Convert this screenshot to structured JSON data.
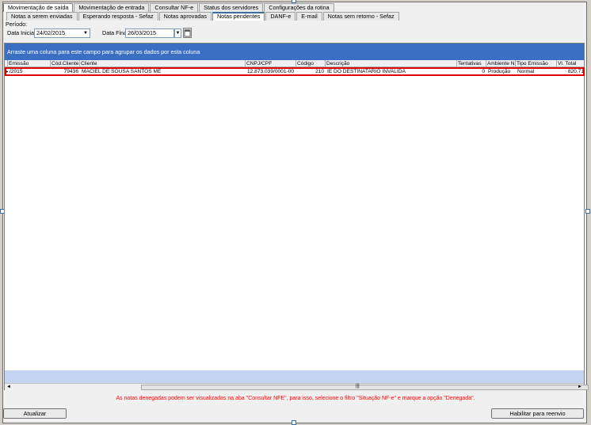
{
  "main_tabs": [
    "Movimentação de saída",
    "Movimentação de entrada",
    "Consultar NF-e",
    "Status dos servidores",
    "Configurações da rotina"
  ],
  "sub_tabs": [
    "Notas a serem enviadas",
    "Esperando resposta - Sefaz",
    "Notas aprovadas",
    "Notas pendentes",
    "DANF-e",
    "E-mail",
    "Notas sem retorno - Sefaz"
  ],
  "filters": {
    "period_label": "Período:",
    "start_label": "Data Inicial",
    "start_value": "24/02/2015",
    "end_label": "Data Final",
    "end_value": "26/03/2015"
  },
  "grid": {
    "group_hint": "Arraste uma coluna para este campo para agrupar os dados por esta coluna",
    "columns": [
      "Emissão",
      "Cód.Cliente",
      "Cliente",
      "CNPJ/CPF",
      "Código",
      "Descrição",
      "Tentativas",
      "Ambiente NF",
      "Tipo Emissão",
      "Vl. Total"
    ],
    "row": {
      "emissao": "/2015",
      "cod_cliente": "79436",
      "cliente": "MACIEL DE SOUSA SANTOS ME",
      "cnpj": "12.873.039/0001-00",
      "codigo": "210",
      "descricao": "IE DO DESTINATARIO INVALIDA",
      "tentativas": "0",
      "ambiente": "Produção",
      "tipo": "Normal",
      "total": "820,71"
    }
  },
  "note": "As notas denegadas podem ser visualizadas na aba \"Consultar NFE\", para isso, selecione o filtro \"Situação NF-e\" e marque a opção \"Denegada\".",
  "buttons": {
    "refresh": "Atualizar",
    "resend": "Habilitar para reenvio"
  }
}
